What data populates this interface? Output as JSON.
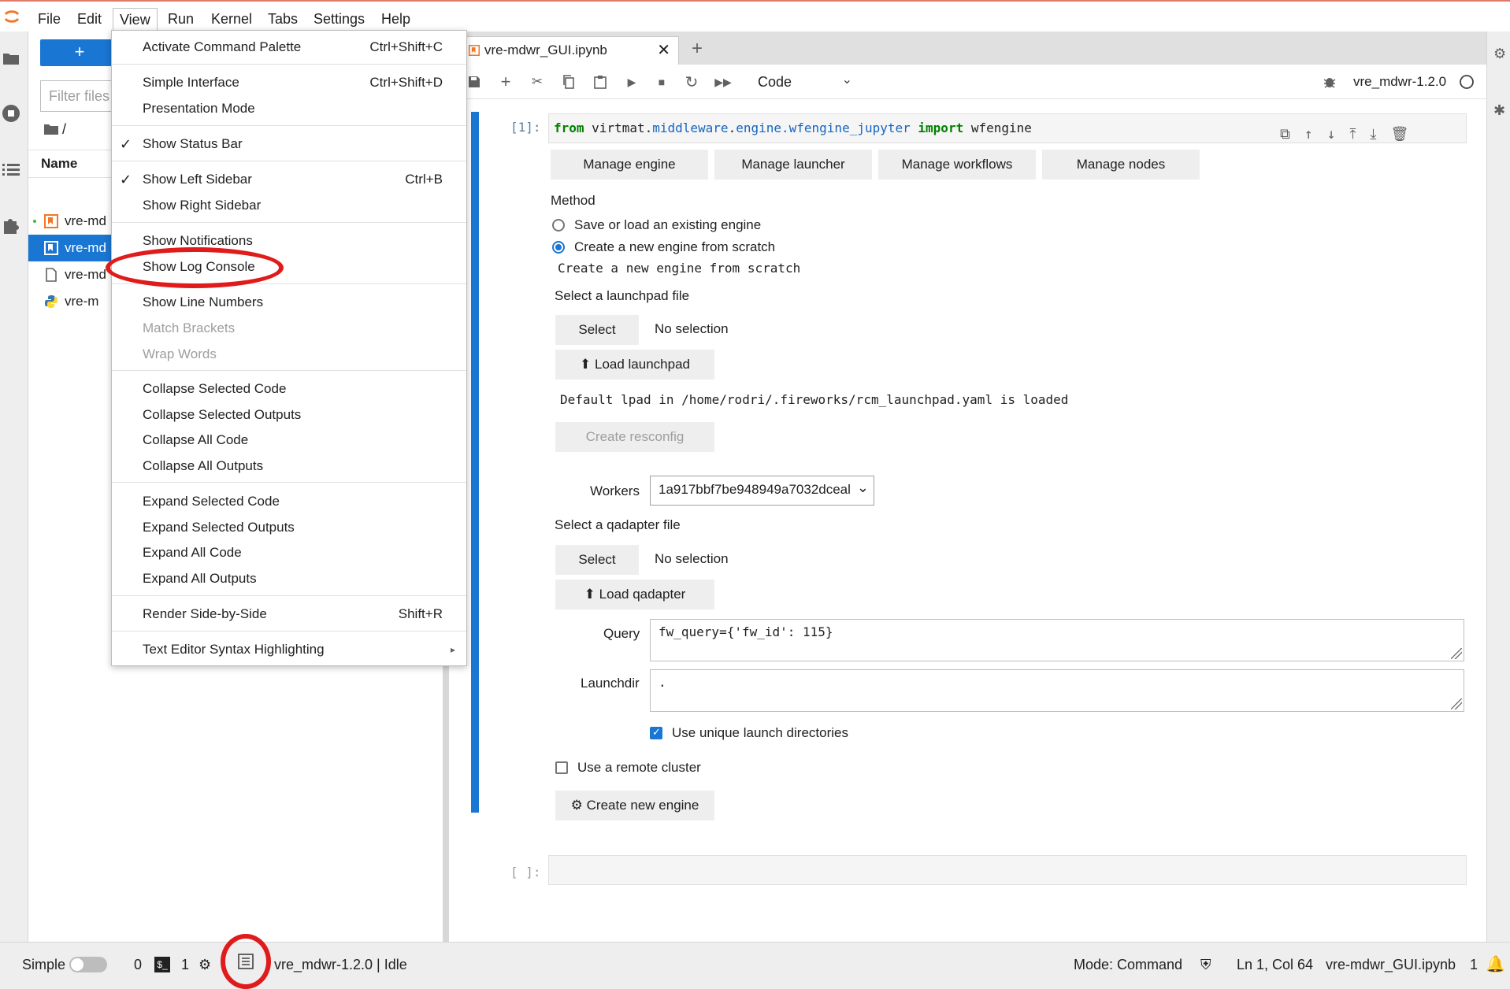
{
  "menubar": {
    "items": [
      "File",
      "Edit",
      "View",
      "Run",
      "Kernel",
      "Tabs",
      "Settings",
      "Help"
    ],
    "active": "View"
  },
  "filebrowser": {
    "new_label": "+",
    "filter_placeholder": "Filter files",
    "breadcrumb": "/",
    "column_name": "Name",
    "files": [
      {
        "name": "vre-md",
        "kind": "notebook-running"
      },
      {
        "name": "vre-md",
        "kind": "notebook-selected"
      },
      {
        "name": "vre-md",
        "kind": "file"
      },
      {
        "name": "vre-m",
        "kind": "python"
      }
    ]
  },
  "notebook": {
    "tab_title": "vre-mdwr_GUI.ipynb",
    "cell_type": "Code",
    "kernel": "vre_mdwr-1.2.0",
    "cell1_prompt": "[1]:",
    "cell1_code": {
      "kw_from": "from",
      "module_pre": "virtmat.",
      "module_mid": "middleware",
      "module_dot": ".",
      "module_end": "engine.wfengine_jupyter",
      "kw_import": "import",
      "name": "wfengine"
    },
    "buttons": [
      "Manage engine",
      "Manage launcher",
      "Manage workflows",
      "Manage nodes"
    ],
    "method_label": "Method",
    "radio_load": "Save or load an existing engine",
    "radio_create": "Create a new engine from scratch",
    "create_output": "Create a new engine from scratch",
    "launchpad_label": "Select a launchpad file",
    "select_label": "Select",
    "no_selection": "No selection",
    "load_launchpad": "Load launchpad",
    "lpad_output": "Default lpad in /home/rodri/.fireworks/rcm_launchpad.yaml is loaded",
    "create_resconfig": "Create resconfig",
    "workers_label": "Workers",
    "workers_value": "1a917bbf7be948949a7032dceal",
    "qadapter_label": "Select a qadapter file",
    "select2_label": "Select",
    "no_selection2": "No selection",
    "load_qadapter": "Load qadapter",
    "query_label": "Query",
    "query_value": "fw_query={'fw_id': 115}",
    "launchdir_label": "Launchdir",
    "launchdir_value": ".",
    "unique_dirs": "Use unique launch directories",
    "remote_cluster": "Use a remote cluster",
    "create_engine": "Create new engine",
    "cell2_prompt": "[ ]:"
  },
  "view_menu": {
    "items": [
      {
        "label": "Activate Command Palette",
        "shortcut": "Ctrl+Shift+C"
      },
      {
        "label": "Simple Interface",
        "shortcut": "Ctrl+Shift+D"
      },
      {
        "label": "Presentation Mode",
        "shortcut": ""
      },
      {
        "label": "Show Status Bar",
        "shortcut": "",
        "checked": true
      },
      {
        "label": "Show Left Sidebar",
        "shortcut": "Ctrl+B",
        "checked": true
      },
      {
        "label": "Show Right Sidebar",
        "shortcut": ""
      },
      {
        "label": "Show Notifications",
        "shortcut": ""
      },
      {
        "label": "Show Log Console",
        "shortcut": ""
      },
      {
        "label": "Show Line Numbers",
        "shortcut": ""
      },
      {
        "label": "Match Brackets",
        "shortcut": "",
        "disabled": true
      },
      {
        "label": "Wrap Words",
        "shortcut": "",
        "disabled": true
      },
      {
        "label": "Collapse Selected Code",
        "shortcut": ""
      },
      {
        "label": "Collapse Selected Outputs",
        "shortcut": ""
      },
      {
        "label": "Collapse All Code",
        "shortcut": ""
      },
      {
        "label": "Collapse All Outputs",
        "shortcut": ""
      },
      {
        "label": "Expand Selected Code",
        "shortcut": ""
      },
      {
        "label": "Expand Selected Outputs",
        "shortcut": ""
      },
      {
        "label": "Expand All Code",
        "shortcut": ""
      },
      {
        "label": "Expand All Outputs",
        "shortcut": ""
      },
      {
        "label": "Render Side-by-Side",
        "shortcut": "Shift+R"
      },
      {
        "label": "Text Editor Syntax Highlighting",
        "shortcut": "",
        "submenu": true
      }
    ],
    "check_glyph": "✓",
    "submenu_glyph": "▸"
  },
  "statusbar": {
    "simple_label": "Simple",
    "terminals": "0",
    "kernels": "1",
    "kernel_status": "vre_mdwr-1.2.0 | Idle",
    "mode": "Mode: Command",
    "position": "Ln 1, Col 64",
    "filename": "vre-mdwr_GUI.ipynb",
    "notifications": "1"
  },
  "colors": {
    "accent": "#1976d2",
    "annotation": "#e01b1b"
  }
}
